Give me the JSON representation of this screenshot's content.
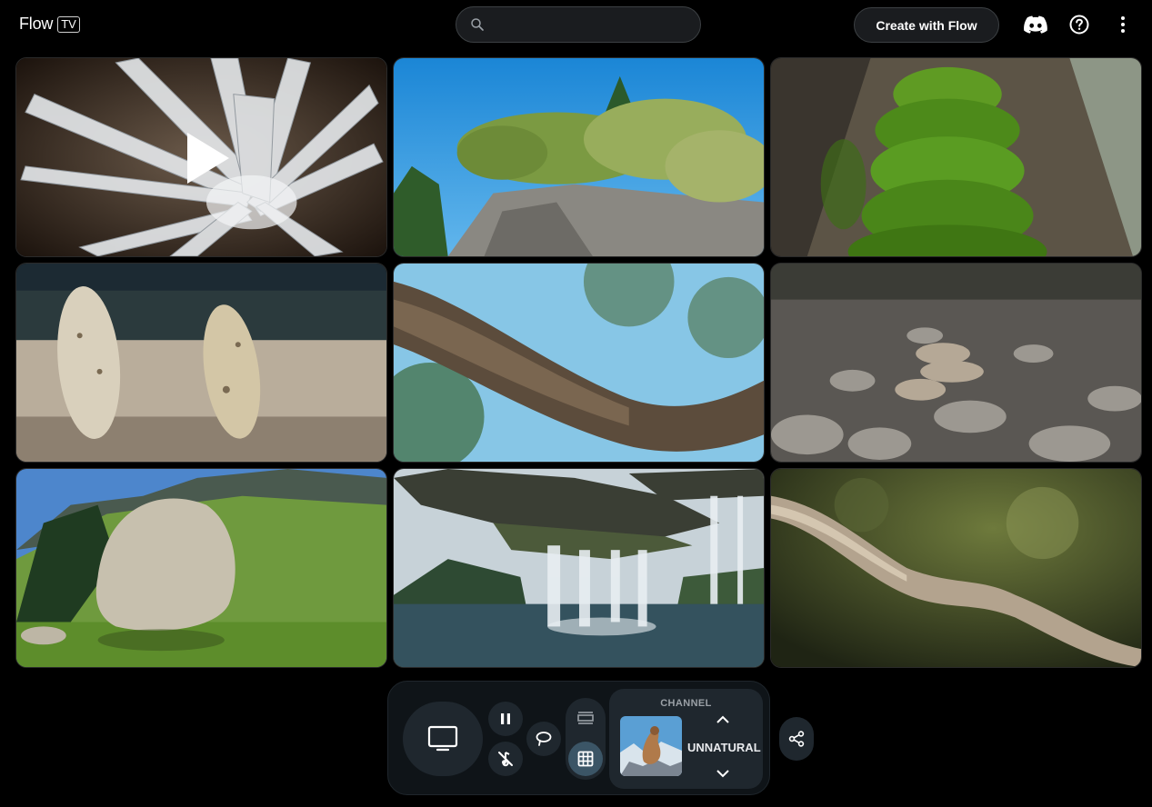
{
  "header": {
    "logo_word": "Flow",
    "logo_badge": "TV",
    "search_placeholder": "",
    "create_label": "Create with Flow",
    "icons": [
      "discord-icon",
      "help-icon",
      "more-vert-icon"
    ]
  },
  "grid": {
    "tiles": [
      {
        "subject": "crystal-cluster",
        "playing": true
      },
      {
        "subject": "cliff-with-flowering-bush"
      },
      {
        "subject": "moss-on-tree-trunk"
      },
      {
        "subject": "standing-pebbles"
      },
      {
        "subject": "tree-branch-sky"
      },
      {
        "subject": "stacked-stones"
      },
      {
        "subject": "boulder-mountain-meadow"
      },
      {
        "subject": "floating-island-waterfalls"
      },
      {
        "subject": "twisted-branch"
      }
    ]
  },
  "controls": {
    "tv_mode_icon": "tv-icon",
    "pause_icon": "pause-icon",
    "mute_icon": "no-audio-icon",
    "loop_icon": "loop-icon",
    "single_view_icon": "single-view-icon",
    "grid_view_icon": "grid-view-icon",
    "active_view": "grid",
    "channel_label": "CHANNEL",
    "channel_name": "UNNATURAL",
    "share_icon": "share-icon"
  },
  "colors": {
    "background": "#000000",
    "panel": "#0f1418",
    "button": "#1f272e",
    "active_view": "#3b5566"
  }
}
